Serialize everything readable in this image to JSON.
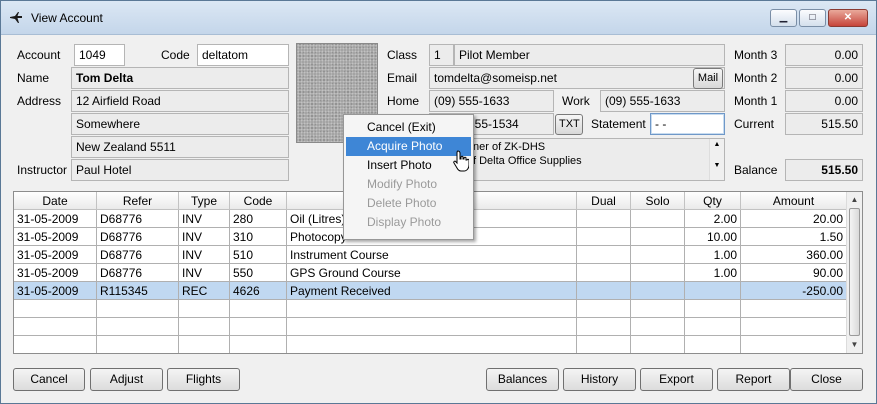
{
  "window": {
    "title": "View Account",
    "colors": {
      "titlebar": "#c4d6ea",
      "selection": "#3e86d6",
      "selected_row": "#c0d8f1"
    }
  },
  "labels": {
    "account": "Account",
    "code": "Code",
    "name": "Name",
    "address": "Address",
    "instructor": "Instructor",
    "class": "Class",
    "email": "Email",
    "home": "Home",
    "work": "Work",
    "statement": "Statement",
    "month3": "Month 3",
    "month2": "Month 2",
    "month1": "Month 1",
    "current": "Current",
    "balance": "Balance"
  },
  "fields": {
    "account": "1049",
    "code": "deltatom",
    "name": "Tom Delta",
    "address1": "12 Airfield Road",
    "address2": "Somewhere",
    "address3": "New Zealand 5511",
    "instructor": "Paul Hotel",
    "class_num": "1",
    "class_name": "Pilot Member",
    "email": "tomdelta@someisp.net",
    "home": "(09) 555-1633",
    "work": "(09) 555-1633",
    "mobile": "555-1534",
    "statement": "- -",
    "month3": "0.00",
    "month2": "0.00",
    "month1": "0.00",
    "current": "515.50",
    "balance": "515.50",
    "notes": [
      "ner of ZK-DHS",
      "f Delta Office Supplies"
    ]
  },
  "small_buttons": {
    "mail": "Mail",
    "txt": "TXT"
  },
  "table": {
    "headers": [
      "Date",
      "Refer",
      "Type",
      "Code",
      "",
      "Dual",
      "Solo",
      "Qty",
      "Amount"
    ],
    "rows": [
      [
        "31-05-2009",
        "D68776",
        "INV",
        "280",
        "Oil (Litres)",
        "",
        "",
        "2.00",
        "20.00"
      ],
      [
        "31-05-2009",
        "D68776",
        "INV",
        "310",
        "Photocopy",
        "",
        "",
        "10.00",
        "1.50"
      ],
      [
        "31-05-2009",
        "D68776",
        "INV",
        "510",
        "Instrument Course",
        "",
        "",
        "1.00",
        "360.00"
      ],
      [
        "31-05-2009",
        "D68776",
        "INV",
        "550",
        "GPS Ground Course",
        "",
        "",
        "1.00",
        "90.00"
      ],
      [
        "31-05-2009",
        "R115345",
        "REC",
        "4626",
        "Payment Received",
        "",
        "",
        "",
        "-250.00"
      ]
    ],
    "selected_row": 4
  },
  "context_menu": {
    "items": [
      "Cancel (Exit)",
      "Acquire Photo",
      "Insert Photo",
      "Modify Photo",
      "Delete Photo",
      "Display Photo"
    ],
    "highlighted": 1,
    "disabled": [
      3,
      4,
      5
    ]
  },
  "bottom_buttons": [
    "Cancel",
    "Adjust",
    "Flights",
    "Balances",
    "History",
    "Export",
    "Report",
    "Close"
  ]
}
